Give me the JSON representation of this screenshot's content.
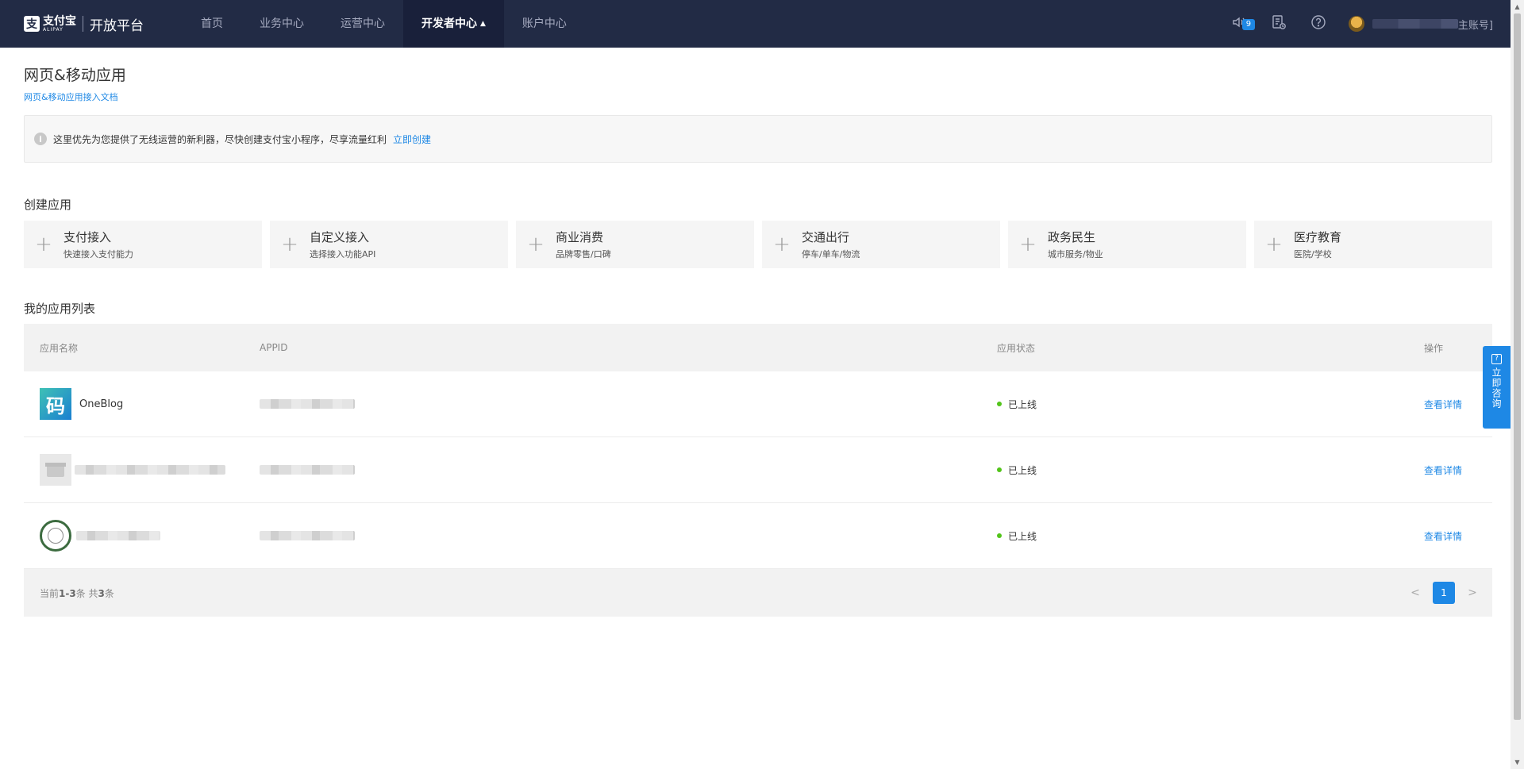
{
  "header": {
    "logo_cn": "支付宝",
    "logo_en": "ALIPAY",
    "platform": "开放平台",
    "nav": [
      {
        "label": "首页"
      },
      {
        "label": "业务中心"
      },
      {
        "label": "运营中心"
      },
      {
        "label": "开发者中心"
      },
      {
        "label": "账户中心"
      }
    ],
    "active_nav": "开发者中心",
    "notification_count": "9",
    "user_suffix": "主账号]"
  },
  "page": {
    "title": "网页&移动应用",
    "doc_link": "网页&移动应用接入文档"
  },
  "notice": {
    "text": "这里优先为您提供了无线运营的新利器，尽快创建支付宝小程序，尽享流量红利",
    "link": "立即创建"
  },
  "create_section": {
    "title": "创建应用",
    "cards": [
      {
        "name": "支付接入",
        "desc": "快速接入支付能力"
      },
      {
        "name": "自定义接入",
        "desc": "选择接入功能API"
      },
      {
        "name": "商业消费",
        "desc": "品牌零售/口碑"
      },
      {
        "name": "交通出行",
        "desc": "停车/单车/物流"
      },
      {
        "name": "政务民生",
        "desc": "城市服务/物业"
      },
      {
        "name": "医疗教育",
        "desc": "医院/学校"
      }
    ]
  },
  "app_list": {
    "title": "我的应用列表",
    "columns": {
      "name": "应用名称",
      "appid": "APPID",
      "status": "应用状态",
      "op": "操作"
    },
    "rows": [
      {
        "name": "OneBlog",
        "icon": "code-char-icon",
        "status": "已上线",
        "op": "查看详情"
      },
      {
        "name": "",
        "icon": "store-placeholder-icon",
        "status": "已上线",
        "op": "查看详情"
      },
      {
        "name": "",
        "icon": "green-ring-logo-icon",
        "status": "已上线",
        "op": "查看详情"
      }
    ],
    "footer_prefix": "当前",
    "footer_range": "1-3",
    "footer_mid": "条 共",
    "footer_total": "3",
    "footer_suffix": "条",
    "current_page": "1"
  },
  "consult": {
    "label": "立即咨询"
  },
  "colors": {
    "nav_bg": "#222b45",
    "accent": "#1e88e5",
    "status_online": "#52c41a"
  }
}
